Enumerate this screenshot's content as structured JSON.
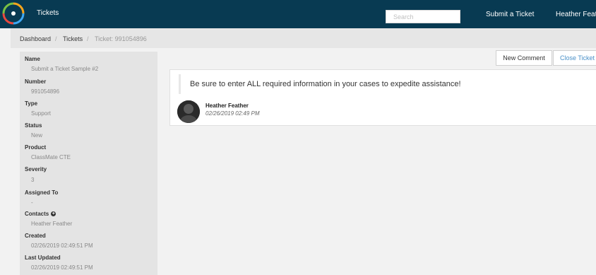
{
  "header": {
    "app_title": "Tickets",
    "search_placeholder": "Search",
    "submit_link": "Submit a Ticket",
    "user_name": "Heather Feath"
  },
  "breadcrumb": {
    "items": [
      "Dashboard",
      "Tickets",
      "Ticket: 991054896"
    ],
    "separator": "/"
  },
  "ticket": {
    "fields": [
      {
        "label": "Name",
        "value": "Submit a Ticket Sample #2"
      },
      {
        "label": "Number",
        "value": "991054896"
      },
      {
        "label": "Type",
        "value": "Support"
      },
      {
        "label": "Status",
        "value": "New"
      },
      {
        "label": "Product",
        "value": "ClassMate CTE"
      },
      {
        "label": "Severity",
        "value": "3"
      },
      {
        "label": "Assigned To",
        "value": "-"
      },
      {
        "label": "Contacts",
        "value": "Heather Feather"
      },
      {
        "label": "Created",
        "value": "02/26/2019 02:49:51 PM"
      },
      {
        "label": "Last Updated",
        "value": "02/26/2019 02:49:51 PM"
      }
    ]
  },
  "actions": {
    "new_comment": "New Comment",
    "close_ticket": "Close Ticket"
  },
  "comment": {
    "text": "Be sure to enter ALL required information in your cases to expedite assistance!",
    "author": "Heather Feather",
    "timestamp": "02/26/2019 02:49 PM"
  },
  "colors": {
    "topbar": "#083a52",
    "link": "#4a90c8"
  }
}
